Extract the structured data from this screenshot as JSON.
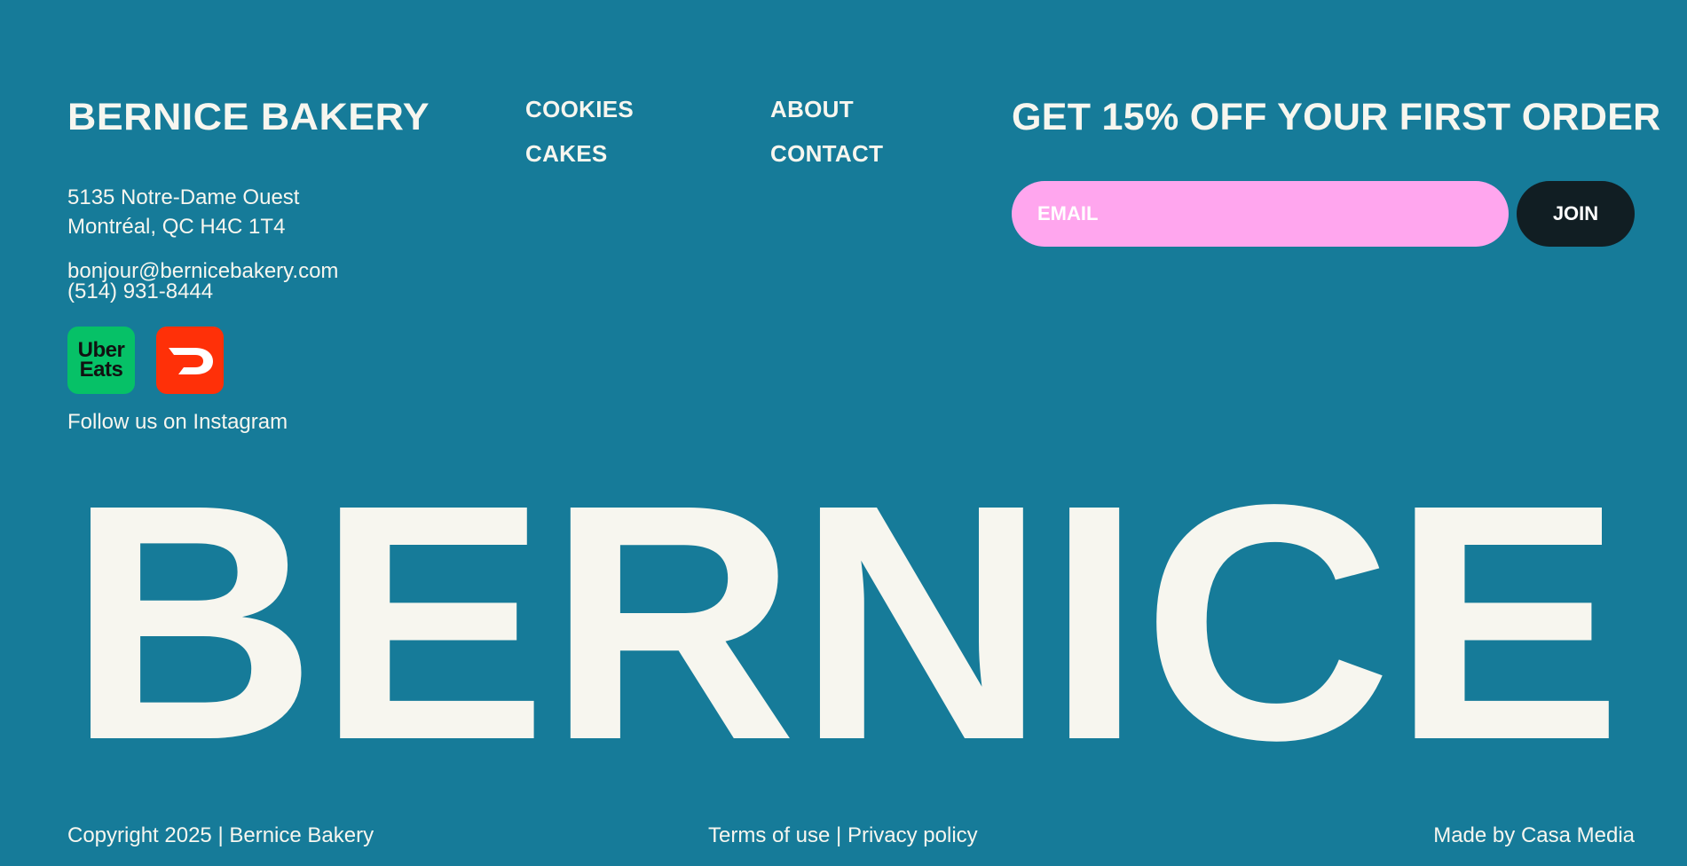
{
  "brand": {
    "name": "BERNICE BAKERY"
  },
  "address": {
    "line1": "5135 Notre-Dame Ouest",
    "line2": "Montréal, QC H4C 1T4"
  },
  "contact": {
    "email": "bonjour@bernicebakery.com",
    "phone": "(514) 931-8444"
  },
  "delivery": [
    {
      "name": "Uber Eats",
      "line1": "Uber",
      "line2": "Eats",
      "icon": "uber-eats-logo",
      "color": "#06c167"
    },
    {
      "name": "DoorDash",
      "icon": "doordash-logo",
      "color": "#ff3008"
    }
  ],
  "instagram": {
    "label": "Follow us on Instagram"
  },
  "nav": {
    "col1": [
      "COOKIES",
      "CAKES"
    ],
    "col2": [
      "ABOUT",
      "CONTACT"
    ]
  },
  "newsletter": {
    "heading": "GET 15% OFF YOUR FIRST ORDER",
    "placeholder": "EMAIL",
    "button": "JOIN"
  },
  "big_wordmark": "BERNICE",
  "footer": {
    "copyright": "Copyright 2025 | Bernice Bakery",
    "legal": "Terms of use | Privacy policy",
    "credit": "Made by Casa Media"
  },
  "colors": {
    "background": "#167b99",
    "text": "#f7f6ef",
    "email_field": "#ffa6ee",
    "join_button": "#111e23"
  }
}
